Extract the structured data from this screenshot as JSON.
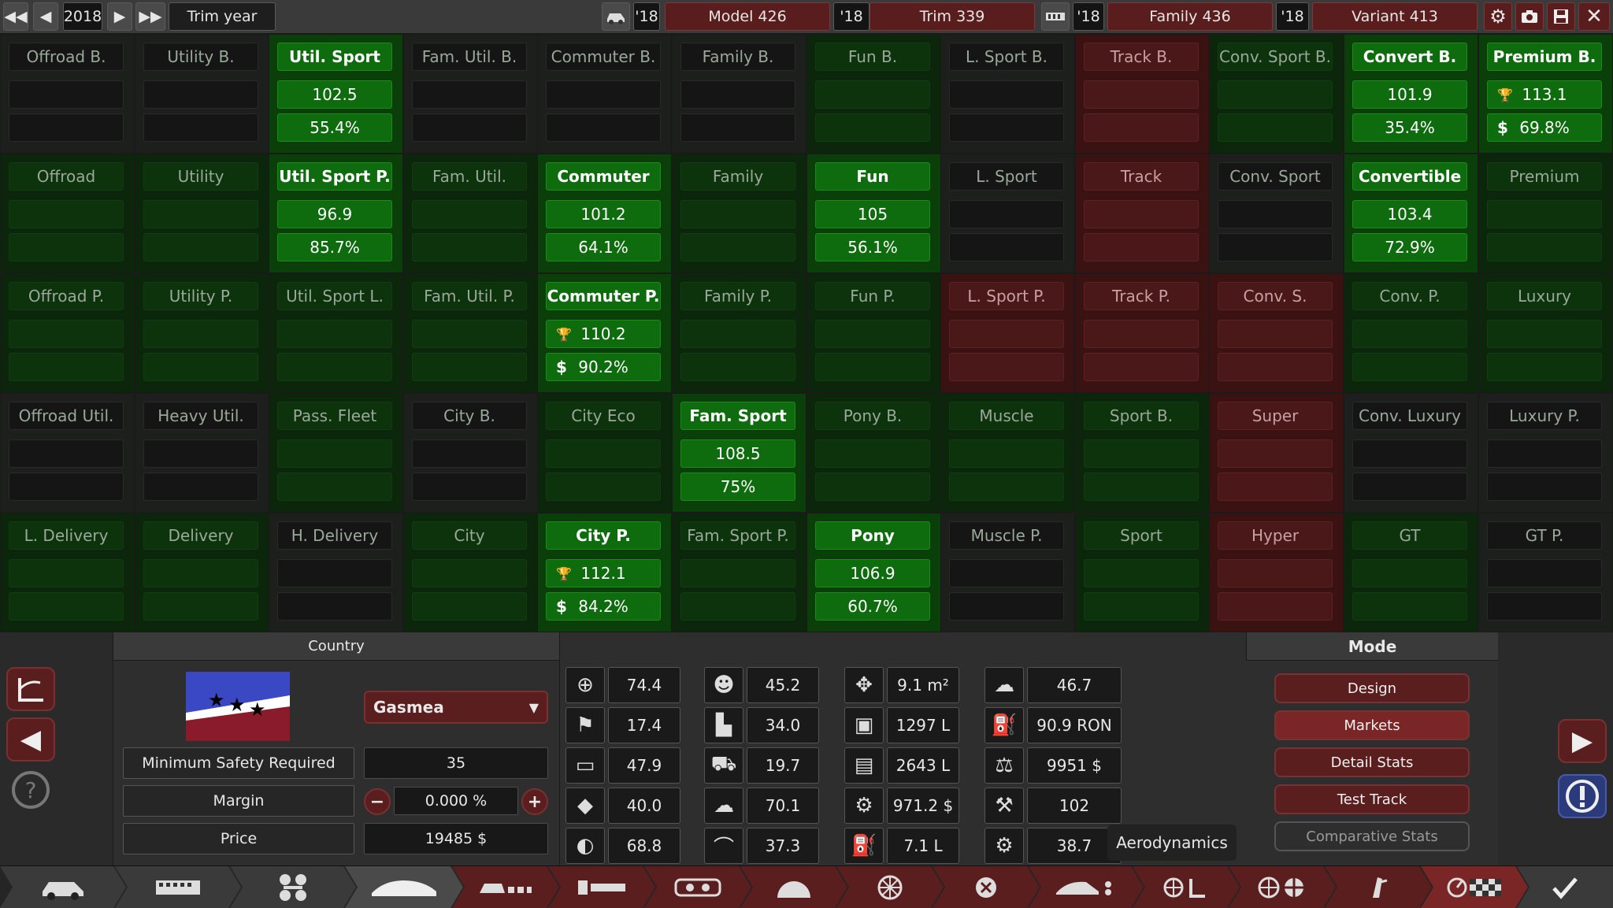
{
  "topbar": {
    "prev_prev": "◀◀",
    "prev": "◀",
    "year": "2018",
    "next": "▶",
    "next_next": "▶▶",
    "trim_year": "Trim year",
    "model_year": "'18",
    "model": "Model 426",
    "trim_model_year": "'18",
    "trim": "Trim 339",
    "family_year": "'18",
    "family": "Family 436",
    "variant_year": "'18",
    "variant": "Variant 413"
  },
  "colors": {
    "green_on": "#0e6b0e",
    "green_mid": "#0a3f0a",
    "green_dim": "#0c2d0c",
    "gray": "#1f221f",
    "red_dim": "#3a1212",
    "red_mid": "#4a1818",
    "accent_red": "#6a2020"
  },
  "markets": [
    {
      "label": "Offroad B.",
      "v1": "",
      "v2": "",
      "color": "gray"
    },
    {
      "label": "Utility B.",
      "v1": "",
      "v2": "",
      "color": "gray"
    },
    {
      "label": "Util. Sport",
      "v1": "102.5",
      "v2": "55.4%",
      "color": "green_on"
    },
    {
      "label": "Fam. Util. B.",
      "v1": "",
      "v2": "",
      "color": "gray"
    },
    {
      "label": "Commuter B.",
      "v1": "",
      "v2": "",
      "color": "gray"
    },
    {
      "label": "Family B.",
      "v1": "",
      "v2": "",
      "color": "gray"
    },
    {
      "label": "Fun B.",
      "v1": "",
      "v2": "",
      "color": "green_dim"
    },
    {
      "label": "L. Sport B.",
      "v1": "",
      "v2": "",
      "color": "gray"
    },
    {
      "label": "Track B.",
      "v1": "",
      "v2": "",
      "color": "red_dim"
    },
    {
      "label": "Conv. Sport B.",
      "v1": "",
      "v2": "",
      "color": "green_dim"
    },
    {
      "label": "Convert B.",
      "v1": "101.9",
      "v2": "35.4%",
      "color": "green_on"
    },
    {
      "label": "Premium B.",
      "v1": "113.1",
      "v2": "69.8%",
      "color": "green_on",
      "ico1": "trophy",
      "ico2": "dollar"
    },
    {
      "label": "Offroad",
      "v1": "",
      "v2": "",
      "color": "green_dim"
    },
    {
      "label": "Utility",
      "v1": "",
      "v2": "",
      "color": "green_dim"
    },
    {
      "label": "Util. Sport P.",
      "v1": "96.9",
      "v2": "85.7%",
      "color": "green_on"
    },
    {
      "label": "Fam. Util.",
      "v1": "",
      "v2": "",
      "color": "green_dim"
    },
    {
      "label": "Commuter",
      "v1": "101.2",
      "v2": "64.1%",
      "color": "green_on"
    },
    {
      "label": "Family",
      "v1": "",
      "v2": "",
      "color": "green_dim"
    },
    {
      "label": "Fun",
      "v1": "105",
      "v2": "56.1%",
      "color": "green_on"
    },
    {
      "label": "L. Sport",
      "v1": "",
      "v2": "",
      "color": "gray"
    },
    {
      "label": "Track",
      "v1": "",
      "v2": "",
      "color": "red_dim"
    },
    {
      "label": "Conv. Sport",
      "v1": "",
      "v2": "",
      "color": "gray"
    },
    {
      "label": "Convertible",
      "v1": "103.4",
      "v2": "72.9%",
      "color": "green_on"
    },
    {
      "label": "Premium",
      "v1": "",
      "v2": "",
      "color": "green_dim"
    },
    {
      "label": "Offroad P.",
      "v1": "",
      "v2": "",
      "color": "green_dim"
    },
    {
      "label": "Utility P.",
      "v1": "",
      "v2": "",
      "color": "green_dim"
    },
    {
      "label": "Util. Sport L.",
      "v1": "",
      "v2": "",
      "color": "green_dim"
    },
    {
      "label": "Fam. Util. P.",
      "v1": "",
      "v2": "",
      "color": "green_dim"
    },
    {
      "label": "Commuter P.",
      "v1": "110.2",
      "v2": "90.2%",
      "color": "green_on",
      "ico1": "trophy",
      "ico2": "dollar"
    },
    {
      "label": "Family P.",
      "v1": "",
      "v2": "",
      "color": "green_dim"
    },
    {
      "label": "Fun P.",
      "v1": "",
      "v2": "",
      "color": "green_dim"
    },
    {
      "label": "L. Sport P.",
      "v1": "",
      "v2": "",
      "color": "red_dim"
    },
    {
      "label": "Track P.",
      "v1": "",
      "v2": "",
      "color": "red_dim"
    },
    {
      "label": "Conv. S.",
      "v1": "",
      "v2": "",
      "color": "red_dim"
    },
    {
      "label": "Conv. P.",
      "v1": "",
      "v2": "",
      "color": "green_dim"
    },
    {
      "label": "Luxury",
      "v1": "",
      "v2": "",
      "color": "green_dim"
    },
    {
      "label": "Offroad Util.",
      "v1": "",
      "v2": "",
      "color": "gray"
    },
    {
      "label": "Heavy Util.",
      "v1": "",
      "v2": "",
      "color": "gray"
    },
    {
      "label": "Pass. Fleet",
      "v1": "",
      "v2": "",
      "color": "green_dim"
    },
    {
      "label": "City B.",
      "v1": "",
      "v2": "",
      "color": "gray"
    },
    {
      "label": "City Eco",
      "v1": "",
      "v2": "",
      "color": "green_dim"
    },
    {
      "label": "Fam. Sport",
      "v1": "108.5",
      "v2": "75%",
      "color": "green_on"
    },
    {
      "label": "Pony B.",
      "v1": "",
      "v2": "",
      "color": "green_dim"
    },
    {
      "label": "Muscle",
      "v1": "",
      "v2": "",
      "color": "green_dim"
    },
    {
      "label": "Sport B.",
      "v1": "",
      "v2": "",
      "color": "green_dim"
    },
    {
      "label": "Super",
      "v1": "",
      "v2": "",
      "color": "red_dim"
    },
    {
      "label": "Conv. Luxury",
      "v1": "",
      "v2": "",
      "color": "gray"
    },
    {
      "label": "Luxury P.",
      "v1": "",
      "v2": "",
      "color": "gray"
    },
    {
      "label": "L. Delivery",
      "v1": "",
      "v2": "",
      "color": "green_dim"
    },
    {
      "label": "Delivery",
      "v1": "",
      "v2": "",
      "color": "green_dim"
    },
    {
      "label": "H. Delivery",
      "v1": "",
      "v2": "",
      "color": "gray"
    },
    {
      "label": "City",
      "v1": "",
      "v2": "",
      "color": "green_dim"
    },
    {
      "label": "City P.",
      "v1": "112.1",
      "v2": "84.2%",
      "color": "green_on",
      "ico1": "trophy",
      "ico2": "dollar"
    },
    {
      "label": "Fam. Sport P.",
      "v1": "",
      "v2": "",
      "color": "green_dim"
    },
    {
      "label": "Pony",
      "v1": "106.9",
      "v2": "60.7%",
      "color": "green_on"
    },
    {
      "label": "Muscle P.",
      "v1": "",
      "v2": "",
      "color": "gray"
    },
    {
      "label": "Sport",
      "v1": "",
      "v2": "",
      "color": "green_dim"
    },
    {
      "label": "Hyper",
      "v1": "",
      "v2": "",
      "color": "red_dim"
    },
    {
      "label": "GT",
      "v1": "",
      "v2": "",
      "color": "green_dim"
    },
    {
      "label": "GT P.",
      "v1": "",
      "v2": "",
      "color": "gray"
    }
  ],
  "country": {
    "header": "Country",
    "selected": "Gasmea",
    "min_safety_label": "Minimum Safety Required",
    "min_safety_value": "35",
    "margin_label": "Margin",
    "margin_value": "0.000 %",
    "price_label": "Price",
    "price_value": "19485 $"
  },
  "stats": [
    {
      "icon": "steering-wheel-icon",
      "glyph": "⊕",
      "value": "74.4"
    },
    {
      "icon": "race-flag-icon",
      "glyph": "⚑",
      "value": "17.4"
    },
    {
      "icon": "seat-icon",
      "glyph": "▭",
      "value": "47.9"
    },
    {
      "icon": "diamond-icon",
      "glyph": "◆",
      "value": "40.0"
    },
    {
      "icon": "crash-test-icon",
      "glyph": "◐",
      "value": "68.8"
    },
    {
      "icon": "passengers-icon",
      "glyph": "☻",
      "value": "45.2"
    },
    {
      "icon": "utility-truck-icon",
      "glyph": "▙",
      "value": "34.0"
    },
    {
      "icon": "offroad-car-icon",
      "glyph": "⛟",
      "value": "19.7"
    },
    {
      "icon": "environment-icon",
      "glyph": "☁",
      "value": "70.1"
    },
    {
      "icon": "comfort-icon",
      "glyph": "⌒",
      "value": "37.3"
    },
    {
      "icon": "dimensions-icon",
      "glyph": "✥",
      "value": "9.1 m²"
    },
    {
      "icon": "cargo-icon",
      "glyph": "▣",
      "value": "1297 L"
    },
    {
      "icon": "passenger-volume-icon",
      "glyph": "▤",
      "value": "2643 L"
    },
    {
      "icon": "service-cost-icon",
      "glyph": "⚙",
      "value": "971.2 $"
    },
    {
      "icon": "fuel-consumption-icon",
      "glyph": "⛽",
      "value": "7.1 L"
    },
    {
      "icon": "emissions-icon",
      "glyph": "☁",
      "value": "46.7"
    },
    {
      "icon": "fuel-type-icon",
      "glyph": "⛽",
      "value": "90.9 RON"
    },
    {
      "icon": "production-cost-icon",
      "glyph": "⚖",
      "value": "9951 $"
    },
    {
      "icon": "production-units-icon",
      "glyph": "⚒",
      "value": "102"
    },
    {
      "icon": "engineering-icon",
      "glyph": "⚙",
      "value": "38.7"
    }
  ],
  "aero_button": "Aerodynamics",
  "mode": {
    "header": "Mode",
    "buttons": [
      "Design",
      "Markets",
      "Detail Stats",
      "Test Track",
      "Comparative Stats"
    ]
  }
}
